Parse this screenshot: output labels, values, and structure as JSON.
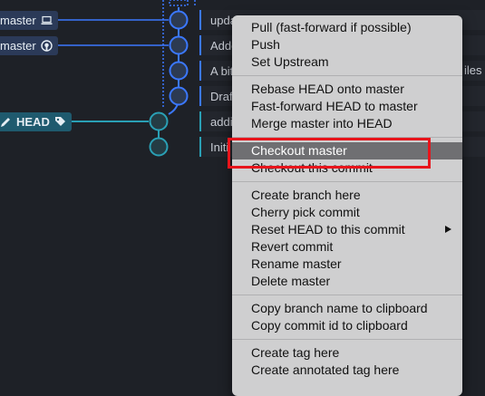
{
  "branches": {
    "master_local": "master",
    "master_remote": "master",
    "head": "HEAD"
  },
  "commits": [
    {
      "message": "upda"
    },
    {
      "message": "Adde"
    },
    {
      "message": "A bit"
    },
    {
      "message": "Draft"
    },
    {
      "message": "addin"
    },
    {
      "message": "Initi"
    }
  ],
  "overflow_text": {
    "files": "iles"
  },
  "context_menu": {
    "group1": [
      "Pull (fast-forward if possible)",
      "Push",
      "Set Upstream"
    ],
    "group2": [
      "Rebase HEAD onto master",
      "Fast-forward HEAD to master",
      "Merge master into HEAD"
    ],
    "group3": [
      "Checkout master",
      "Checkout this commit"
    ],
    "group4": [
      "Create branch here",
      "Cherry pick commit",
      "Reset HEAD to this commit",
      "Revert commit",
      "Rename master",
      "Delete master"
    ],
    "group5": [
      "Copy branch name to clipboard",
      "Copy commit id to clipboard"
    ],
    "group6": [
      "Create tag here",
      "Create annotated tag here"
    ],
    "highlighted_item": "Checkout master"
  },
  "colors": {
    "background": "#1e2127",
    "branch_blue": "#3b78ff",
    "branch_teal": "#2aa0b5",
    "menu_background": "#cfcfd0",
    "menu_active": "#6f6f72",
    "highlight_box": "#e8141b"
  },
  "icons": [
    "laptop-icon",
    "github-icon",
    "pencil-icon",
    "tag-icon",
    "submenu-arrow-icon"
  ]
}
